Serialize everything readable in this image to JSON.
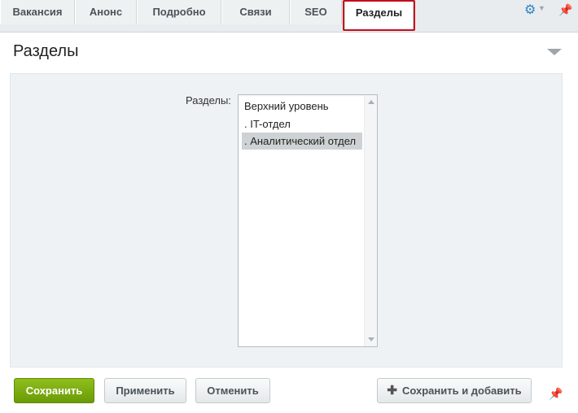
{
  "tabs": [
    {
      "label": "Вакансия"
    },
    {
      "label": "Анонс"
    },
    {
      "label": "Подробно"
    },
    {
      "label": "Связи"
    },
    {
      "label": "SEO"
    },
    {
      "label": "Разделы"
    }
  ],
  "active_tab": "Разделы",
  "icons": {
    "settings": "gear-icon",
    "pin": "pin-icon",
    "collapse": "triangle-down-icon",
    "add": "plus-icon"
  },
  "colors": {
    "highlight": "#c40c1c",
    "primary_button": "#7aa90f",
    "gear": "#2b83c7"
  },
  "panel": {
    "title": "Разделы"
  },
  "sections_field": {
    "label": "Разделы:",
    "options": [
      {
        "label": "Верхний уровень",
        "selected": false
      },
      {
        "label": ". IT-отдел",
        "selected": false
      },
      {
        "label": ". Аналитический отдел",
        "selected": true
      }
    ]
  },
  "footer": {
    "save": "Сохранить",
    "apply": "Применить",
    "cancel": "Отменить",
    "save_add": "Сохранить и добавить"
  }
}
